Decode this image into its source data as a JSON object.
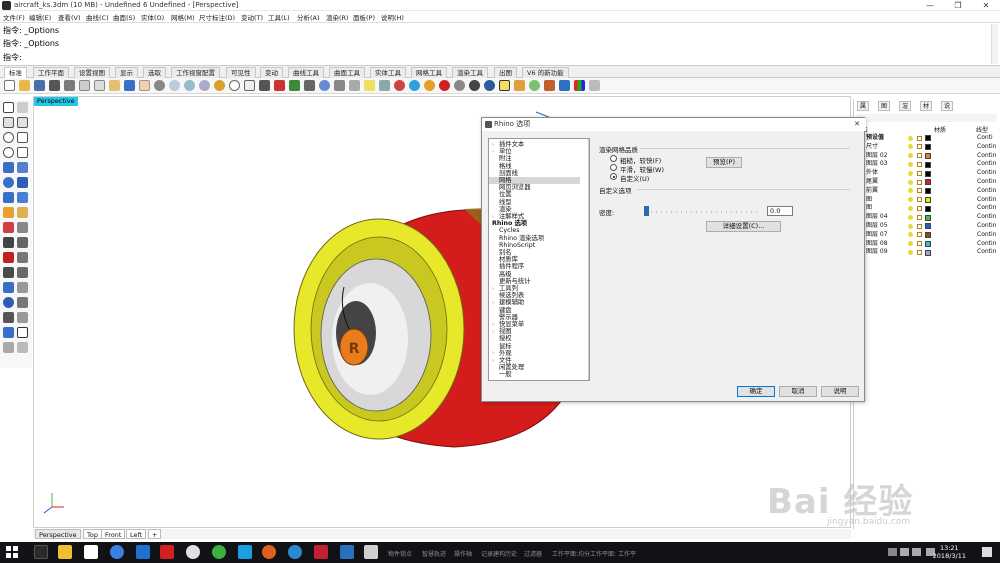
{
  "window": {
    "title": "aircraft_ks.3dm (10 MB) - Undefined 6 Undefined - [Perspective]",
    "minimize": "—",
    "maximize": "❐",
    "close": "✕"
  },
  "menu": [
    "文件(F)",
    "编辑(E)",
    "查看(V)",
    "曲线(C)",
    "曲面(S)",
    "实体(O)",
    "网格(M)",
    "尺寸标注(D)",
    "变动(T)",
    "工具(L)",
    "分析(A)",
    "渲染(R)",
    "面板(P)",
    "说明(H)"
  ],
  "command": {
    "history": [
      "指令: _Options",
      "指令: _Options"
    ],
    "prompt": "指令:"
  },
  "toolbar_tabs": [
    "标准",
    "工作平面",
    "设置视图",
    "显示",
    "选取",
    "工作视窗配置",
    "可见性",
    "变动",
    "曲线工具",
    "曲面工具",
    "实体工具",
    "网格工具",
    "渲染工具",
    "出图",
    "V6 的新功能"
  ],
  "viewport": {
    "label": "Perspective",
    "tabs": [
      "Perspective",
      "Top",
      "Front",
      "Left"
    ],
    "add_tab": "+"
  },
  "right_panel": {
    "tabs": [
      "属",
      "图",
      "渲",
      "材",
      "说"
    ],
    "columns": [
      "名",
      "材质",
      "线型"
    ],
    "layers": [
      {
        "name": "预设值",
        "color": "#000000",
        "linetype": "Conti",
        "bold": true
      },
      {
        "name": "尺寸",
        "color": "#000000",
        "linetype": "Contin"
      },
      {
        "name": "图层 02",
        "color": "#e87d1e",
        "linetype": "Contin"
      },
      {
        "name": "图层 03",
        "color": "#000000",
        "linetype": "Contin"
      },
      {
        "name": "外体",
        "color": "#000000",
        "linetype": "Contin"
      },
      {
        "name": "尾翼",
        "color": "#d42020",
        "linetype": "Contin"
      },
      {
        "name": "前翼",
        "color": "#000000",
        "linetype": "Contin"
      },
      {
        "name": "图",
        "color": "#f2e600",
        "linetype": "Contin"
      },
      {
        "name": "图",
        "color": "#000000",
        "linetype": "Contin"
      },
      {
        "name": "图层 04",
        "color": "#3cc23c",
        "linetype": "Contin"
      },
      {
        "name": "图层 05",
        "color": "#2060d0",
        "linetype": "Contin"
      },
      {
        "name": "图层 07",
        "color": "#8a4a20",
        "linetype": "Contin"
      },
      {
        "name": "图层 08",
        "color": "#22c8d8",
        "linetype": "Contin"
      },
      {
        "name": "图层 09",
        "color": "#a0a0d8",
        "linetype": "Contin"
      }
    ]
  },
  "dialog": {
    "title": "Rhino 选项",
    "tree": [
      {
        "label": "插件文本",
        "expander": true
      },
      {
        "label": "单位",
        "expander": true
      },
      {
        "label": "附注"
      },
      {
        "label": "格线"
      },
      {
        "label": "剖面线"
      },
      {
        "label": "网格",
        "selected": true
      },
      {
        "label": "网页浏览器"
      },
      {
        "label": "位置"
      },
      {
        "label": "线型"
      },
      {
        "label": "渲染"
      },
      {
        "label": "注解样式",
        "expander": true
      },
      {
        "label": "Rhino 选项",
        "bold": true
      },
      {
        "label": "Cycles"
      },
      {
        "label": "Rhino 渲染选项"
      },
      {
        "label": "RhinoScript"
      },
      {
        "label": "别名"
      },
      {
        "label": "材质库"
      },
      {
        "label": "插件程序"
      },
      {
        "label": "高级"
      },
      {
        "label": "更新与统计"
      },
      {
        "label": "工具列",
        "expander": true
      },
      {
        "label": "候选列表"
      },
      {
        "label": "建模辅助",
        "expander": true
      },
      {
        "label": "键盘"
      },
      {
        "label": "警示器"
      },
      {
        "label": "快显菜单",
        "expander": true
      },
      {
        "label": "视图",
        "expander": true
      },
      {
        "label": "授权"
      },
      {
        "label": "鼠标"
      },
      {
        "label": "外观",
        "expander": true
      },
      {
        "label": "文件",
        "expander": true
      },
      {
        "label": "闲置处理"
      },
      {
        "label": "一般"
      }
    ],
    "quality_header": "渲染网格品质",
    "quality_options": [
      {
        "label": "粗糙，较快(F)",
        "checked": false
      },
      {
        "label": "平滑，较慢(W)",
        "checked": false
      },
      {
        "label": "自定义(U)",
        "checked": true
      }
    ],
    "preview_button": "预览(P)",
    "custom_header": "自定义选项",
    "density_label": "密度:",
    "density_value": "0.0",
    "density_level": 0,
    "detail_button": "详细设置(C)...",
    "ok": "确定",
    "cancel": "取消",
    "help": "说明"
  },
  "taskbar": {
    "status": [
      "物件锁点",
      "智慧轨迹",
      "操作轴",
      "记录建构历史",
      "过滤器",
      "工作平面:均分工作平面: 工作平"
    ],
    "time": "13:21",
    "date": "2018/3/11"
  },
  "watermark": {
    "brand": "Bai 经验",
    "url": "jingyan.baidu.com"
  },
  "colors": {
    "viewport_label": "#23c7e8",
    "engine_red": "#d41c1c",
    "engine_yellow": "#e8e82a",
    "accent_blue": "#0078d7"
  }
}
